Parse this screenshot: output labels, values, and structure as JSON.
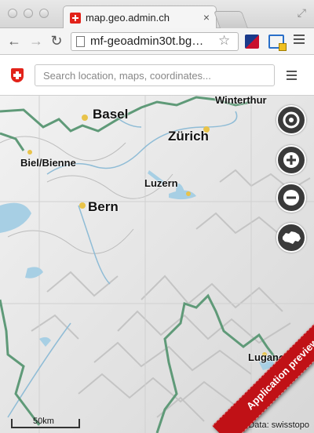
{
  "browser": {
    "tab_title": "map.geo.admin.ch",
    "tab_close": "×",
    "url": "mf-geoadmin30t.bg…",
    "back": "←",
    "forward": "→",
    "reload": "↻",
    "bookmark": "☆",
    "fullscreen": "⤢"
  },
  "app": {
    "search_placeholder": "Search location, maps, coordinates..."
  },
  "map": {
    "cities": [
      "Basel",
      "Winterthur",
      "Zürich",
      "Biel/Bienne",
      "Luzern",
      "Bern",
      "Lugano"
    ],
    "buttons": {
      "locate_icon": "target-icon",
      "zoom_in": "+",
      "zoom_out": "−",
      "switzerland_icon": "switzerland-icon"
    },
    "scale": "50km",
    "attribution": "Data: swisstopo",
    "ribbon": "Application preview",
    "colors": {
      "border_green": "#5f9a78",
      "button_bg": "#3a3a3a",
      "ribbon_red": "#c01116"
    }
  }
}
